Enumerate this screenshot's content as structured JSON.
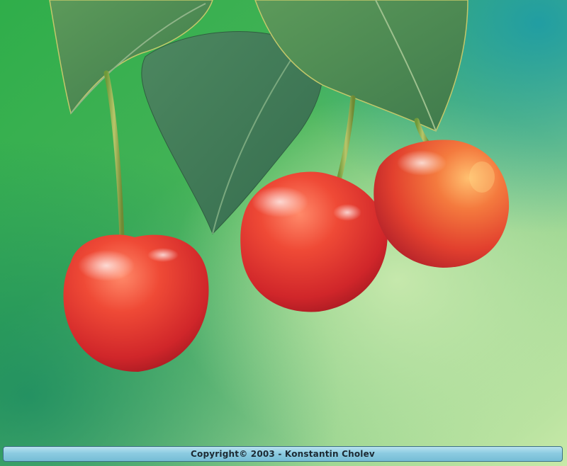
{
  "photo": {
    "subject": "three-red-cherries-with-leaves"
  },
  "caption": {
    "text": "Copyright© 2003 - Konstantin Cholev"
  },
  "colors": {
    "background_green": "#1f9c5a",
    "background_light": "#bfe4a6",
    "cherry_red": "#e0392e",
    "leaf_green": "#4f8a55",
    "caption_bar": "#8ccbe1"
  }
}
